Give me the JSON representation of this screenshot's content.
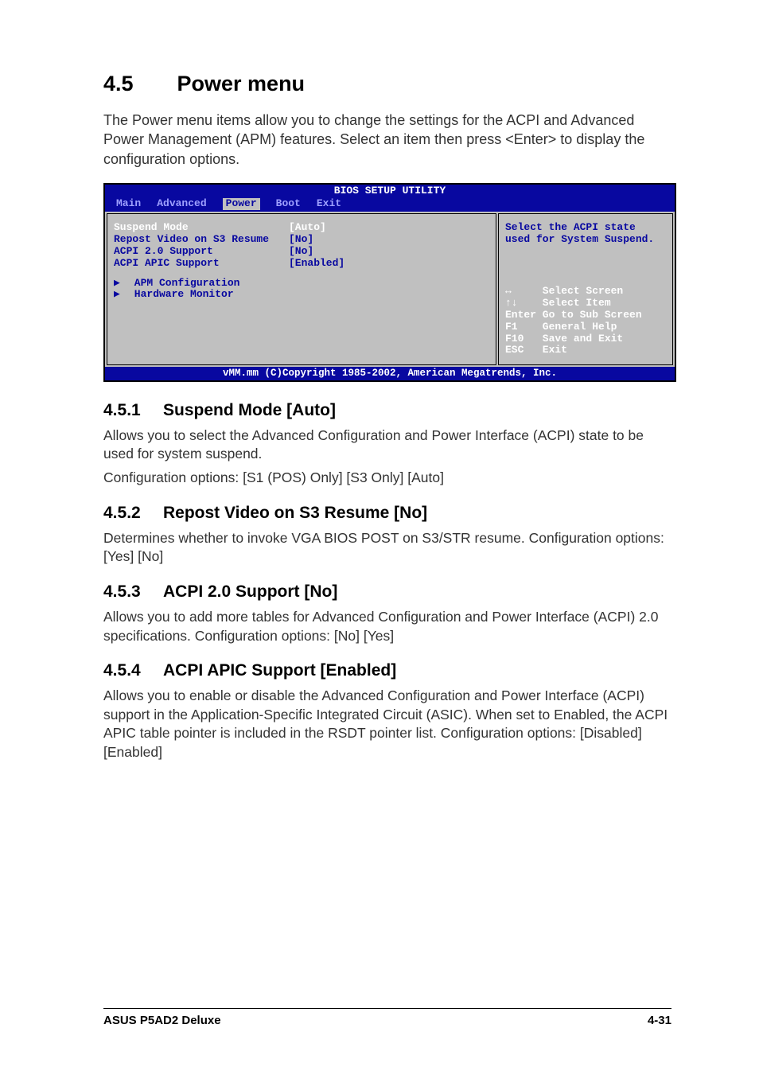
{
  "header": {
    "number": "4.5",
    "title": "Power menu"
  },
  "intro": "The Power menu items allow you to change the settings for the ACPI and Advanced Power Management (APM) features. Select an item then press <Enter> to display the configuration options.",
  "bios": {
    "title": "BIOS SETUP UTILITY",
    "tabs": [
      "Main",
      "Advanced",
      "Power",
      "Boot",
      "Exit"
    ],
    "active_tab_index": 2,
    "items": [
      {
        "label": "Suspend Mode",
        "value": "[Auto]",
        "highlight": true
      },
      {
        "label": "Repost Video on S3 Resume",
        "value": "[No]"
      },
      {
        "label": "ACPI 2.0 Support",
        "value": "[No]"
      },
      {
        "label": "ACPI APIC Support",
        "value": "[Enabled]"
      }
    ],
    "submenus": [
      "APM Configuration",
      "Hardware Monitor"
    ],
    "help_text": "Select the ACPI state used for System Suspend.",
    "keys": [
      {
        "k": "↔",
        "d": "Select Screen"
      },
      {
        "k": "↑↓",
        "d": "Select Item"
      },
      {
        "k": "Enter",
        "d": "Go to Sub Screen"
      },
      {
        "k": "F1",
        "d": "General Help"
      },
      {
        "k": "F10",
        "d": "Save and Exit"
      },
      {
        "k": "ESC",
        "d": "Exit"
      }
    ],
    "footer": "vMM.mm (C)Copyright 1985-2002, American Megatrends, Inc."
  },
  "subsections": [
    {
      "num": "4.5.1",
      "title": "Suspend Mode [Auto]",
      "paras": [
        "Allows you to select the Advanced Configuration and Power Interface (ACPI) state to be used for system suspend.",
        "Configuration options: [S1 (POS) Only] [S3 Only] [Auto]"
      ]
    },
    {
      "num": "4.5.2",
      "title": "Repost Video on S3 Resume [No]",
      "paras": [
        "Determines whether to invoke VGA BIOS POST on S3/STR resume. Configuration options: [Yes] [No]"
      ]
    },
    {
      "num": "4.5.3",
      "title": "ACPI 2.0 Support [No]",
      "paras": [
        "Allows you to add more tables for Advanced Configuration and Power Interface (ACPI) 2.0 specifications. Configuration options: [No] [Yes]"
      ]
    },
    {
      "num": "4.5.4",
      "title": "ACPI APIC Support [Enabled]",
      "paras": [
        "Allows you to enable or disable the Advanced Configuration and Power Interface (ACPI) support in the Application-Specific Integrated Circuit (ASIC). When set to Enabled, the ACPI APIC table pointer is included in the RSDT pointer list. Configuration options: [Disabled] [Enabled]"
      ]
    }
  ],
  "footer": {
    "left": "ASUS P5AD2 Deluxe",
    "right": "4-31"
  }
}
